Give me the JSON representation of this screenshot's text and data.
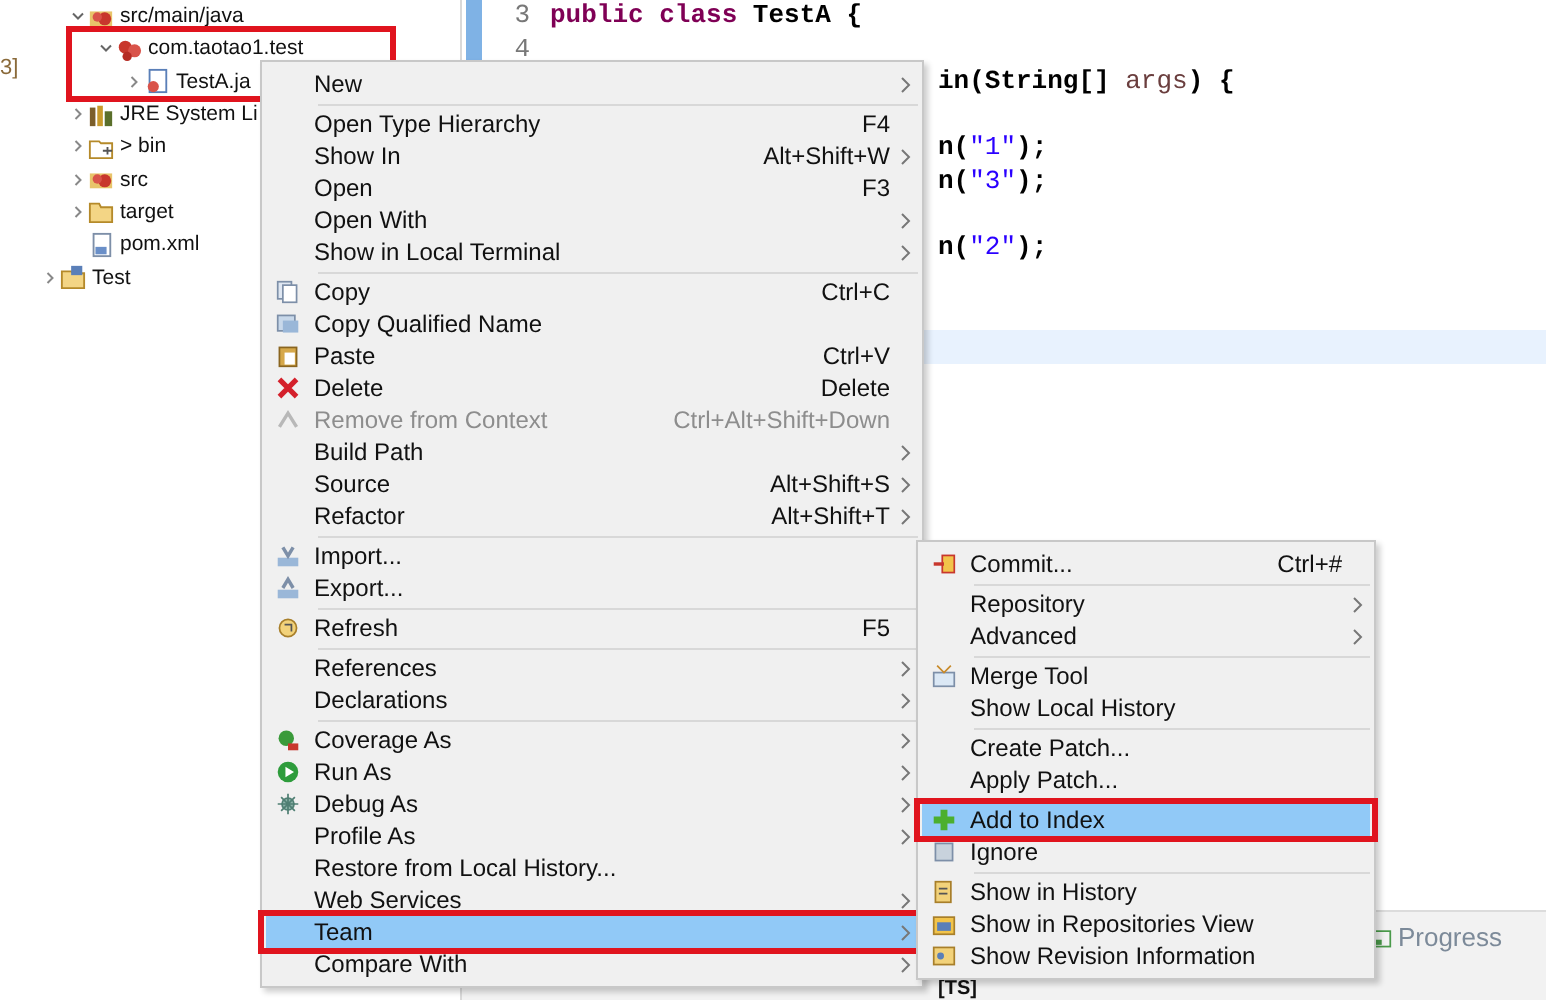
{
  "left_edge_text": "3]",
  "tree": [
    {
      "children": [
        {
          "label": "src/main/java",
          "kind": "sourcefolder",
          "expanded": true,
          "boxed": false,
          "children": [
            {
              "label": "com.taotao1.test",
              "kind": "package",
              "expanded": true,
              "boxed": true,
              "children": [
                {
                  "label": "TestA.ja",
                  "kind": "javafile",
                  "expanded": false,
                  "boxed": false
                }
              ]
            }
          ]
        },
        {
          "label": "JRE System Li",
          "kind": "library",
          "expanded": false,
          "boxed": false
        },
        {
          "label": "> bin",
          "kind": "changedfolder",
          "expanded": false,
          "boxed": false
        },
        {
          "label": "src",
          "kind": "sourcefolder",
          "expanded": false,
          "boxed": false
        },
        {
          "label": "target",
          "kind": "folder",
          "expanded": false,
          "boxed": false
        },
        {
          "label": "pom.xml",
          "kind": "xmlfile",
          "boxed": false
        }
      ]
    },
    {
      "label": "Test",
      "kind": "project",
      "expanded": false,
      "boxed": false
    }
  ],
  "editor": {
    "lines": [
      {
        "number": "3",
        "tokens": [
          {
            "kind": "keyword",
            "text": "public class"
          },
          {
            "kind": "plain",
            "text": " TestA {"
          }
        ]
      },
      {
        "number": "4"
      },
      {
        "tokens": [
          {
            "kind": "plain",
            "text": "in(String[] "
          },
          {
            "kind": "variable",
            "text": "args"
          },
          {
            "kind": "plain",
            "text": ") {"
          }
        ]
      },
      {
        "tokens": [
          {
            "kind": "plain",
            "text": "n("
          },
          {
            "kind": "string",
            "text": "\"1\""
          },
          {
            "kind": "plain",
            "text": ");"
          }
        ]
      },
      {
        "tokens": [
          {
            "kind": "plain",
            "text": "n("
          },
          {
            "kind": "string",
            "text": "\"3\""
          },
          {
            "kind": "plain",
            "text": ");"
          }
        ]
      },
      {
        "tokens": [
          {
            "kind": "plain",
            "text": "n("
          },
          {
            "kind": "string",
            "text": "\"2\""
          },
          {
            "kind": "plain",
            "text": ");"
          }
        ]
      },
      {
        "current": true
      }
    ]
  },
  "bottom_panel": {
    "tabs": [
      {
        "label": "Progress",
        "selected": false
      }
    ],
    "text": "[TS]"
  },
  "context_menu": [
    {
      "kind": "item",
      "label": "New",
      "submenu": true,
      "disabled": false,
      "selected": false,
      "boxed": false
    },
    {
      "kind": "separator"
    },
    {
      "kind": "item",
      "label": "Open Type Hierarchy",
      "shortcut": "F4",
      "submenu": false,
      "disabled": false,
      "selected": false,
      "boxed": false
    },
    {
      "kind": "item",
      "label": "Show In",
      "shortcut": "Alt+Shift+W",
      "submenu": true,
      "disabled": false,
      "selected": false,
      "boxed": false
    },
    {
      "kind": "item",
      "label": "Open",
      "shortcut": "F3",
      "submenu": false,
      "disabled": false,
      "selected": false,
      "boxed": false
    },
    {
      "kind": "item",
      "label": "Open With",
      "submenu": true,
      "disabled": false,
      "selected": false,
      "boxed": false
    },
    {
      "kind": "item",
      "label": "Show in Local Terminal",
      "submenu": true,
      "disabled": false,
      "selected": false,
      "boxed": false
    },
    {
      "kind": "separator"
    },
    {
      "kind": "item",
      "label": "Copy",
      "shortcut": "Ctrl+C",
      "submenu": false,
      "disabled": false,
      "selected": false,
      "boxed": false
    },
    {
      "kind": "item",
      "label": "Copy Qualified Name",
      "submenu": false,
      "disabled": false,
      "selected": false,
      "boxed": false
    },
    {
      "kind": "item",
      "label": "Paste",
      "shortcut": "Ctrl+V",
      "submenu": false,
      "disabled": false,
      "selected": false,
      "boxed": false
    },
    {
      "kind": "item",
      "label": "Delete",
      "shortcut": "Delete",
      "submenu": false,
      "disabled": false,
      "selected": false,
      "boxed": false
    },
    {
      "kind": "item",
      "label": "Remove from Context",
      "shortcut": "Ctrl+Alt+Shift+Down",
      "submenu": false,
      "disabled": true,
      "selected": false,
      "boxed": false
    },
    {
      "kind": "item",
      "label": "Build Path",
      "submenu": true,
      "disabled": false,
      "selected": false,
      "boxed": false
    },
    {
      "kind": "item",
      "label": "Source",
      "shortcut": "Alt+Shift+S",
      "submenu": true,
      "disabled": false,
      "selected": false,
      "boxed": false
    },
    {
      "kind": "item",
      "label": "Refactor",
      "shortcut": "Alt+Shift+T",
      "submenu": true,
      "disabled": false,
      "selected": false,
      "boxed": false
    },
    {
      "kind": "separator"
    },
    {
      "kind": "item",
      "label": "Import...",
      "submenu": false,
      "disabled": false,
      "selected": false,
      "boxed": false
    },
    {
      "kind": "item",
      "label": "Export...",
      "submenu": false,
      "disabled": false,
      "selected": false,
      "boxed": false
    },
    {
      "kind": "separator"
    },
    {
      "kind": "item",
      "label": "Refresh",
      "shortcut": "F5",
      "submenu": false,
      "disabled": false,
      "selected": false,
      "boxed": false
    },
    {
      "kind": "separator"
    },
    {
      "kind": "item",
      "label": "References",
      "submenu": true,
      "disabled": false,
      "selected": false,
      "boxed": false
    },
    {
      "kind": "item",
      "label": "Declarations",
      "submenu": true,
      "disabled": false,
      "selected": false,
      "boxed": false
    },
    {
      "kind": "separator"
    },
    {
      "kind": "item",
      "label": "Coverage As",
      "submenu": true,
      "disabled": false,
      "selected": false,
      "boxed": false
    },
    {
      "kind": "item",
      "label": "Run As",
      "submenu": true,
      "disabled": false,
      "selected": false,
      "boxed": false
    },
    {
      "kind": "item",
      "label": "Debug As",
      "submenu": true,
      "disabled": false,
      "selected": false,
      "boxed": false
    },
    {
      "kind": "item",
      "label": "Profile As",
      "submenu": true,
      "disabled": false,
      "selected": false,
      "boxed": false
    },
    {
      "kind": "item",
      "label": "Restore from Local History...",
      "submenu": false,
      "disabled": false,
      "selected": false,
      "boxed": false
    },
    {
      "kind": "item",
      "label": "Web Services",
      "submenu": true,
      "disabled": false,
      "selected": false,
      "boxed": false
    },
    {
      "kind": "item",
      "label": "Team",
      "submenu": true,
      "disabled": false,
      "selected": true,
      "boxed": true
    },
    {
      "kind": "item",
      "label": "Compare With",
      "submenu": true,
      "disabled": false,
      "selected": false,
      "boxed": false
    }
  ],
  "team_submenu": [
    {
      "kind": "item",
      "label": "Commit...",
      "shortcut": "Ctrl+#",
      "submenu": false,
      "disabled": false,
      "selected": false,
      "boxed": false
    },
    {
      "kind": "separator"
    },
    {
      "kind": "item",
      "label": "Repository",
      "submenu": true,
      "disabled": false,
      "selected": false,
      "boxed": false
    },
    {
      "kind": "item",
      "label": "Advanced",
      "submenu": true,
      "disabled": false,
      "selected": false,
      "boxed": false
    },
    {
      "kind": "separator"
    },
    {
      "kind": "item",
      "label": "Merge Tool",
      "submenu": false,
      "disabled": false,
      "selected": false,
      "boxed": false
    },
    {
      "kind": "item",
      "label": "Show Local History",
      "submenu": false,
      "disabled": false,
      "selected": false,
      "boxed": false
    },
    {
      "kind": "separator"
    },
    {
      "kind": "item",
      "label": "Create Patch...",
      "submenu": false,
      "disabled": false,
      "selected": false,
      "boxed": false
    },
    {
      "kind": "item",
      "label": "Apply Patch...",
      "submenu": false,
      "disabled": false,
      "selected": false,
      "boxed": false
    },
    {
      "kind": "separator"
    },
    {
      "kind": "item",
      "label": "Add to Index",
      "submenu": false,
      "disabled": false,
      "selected": true,
      "boxed": true
    },
    {
      "kind": "item",
      "label": "Ignore",
      "submenu": false,
      "disabled": false,
      "selected": false,
      "boxed": false
    },
    {
      "kind": "separator"
    },
    {
      "kind": "item",
      "label": "Show in History",
      "submenu": false,
      "disabled": false,
      "selected": false,
      "boxed": false
    },
    {
      "kind": "item",
      "label": "Show in Repositories View",
      "submenu": false,
      "disabled": false,
      "selected": false,
      "boxed": false
    },
    {
      "kind": "item",
      "label": "Show Revision Information",
      "submenu": false,
      "disabled": false,
      "selected": false,
      "boxed": false
    }
  ]
}
